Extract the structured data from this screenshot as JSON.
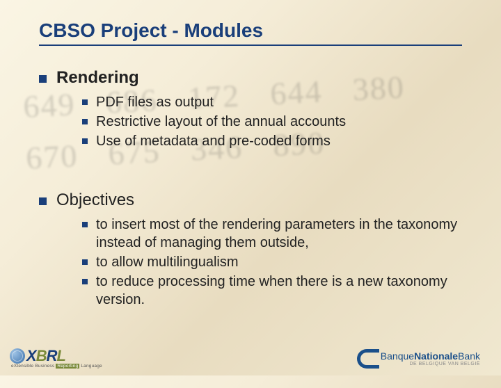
{
  "bg_numbers": "649 686 172 644\n380 670 675\n346 890",
  "title": "CBSO Project - Modules",
  "sections": [
    {
      "heading": "Rendering",
      "bold": true,
      "items": [
        "PDF files as output",
        "Restrictive layout of the annual accounts",
        "Use of metadata and pre-coded forms"
      ]
    },
    {
      "heading": "Objectives",
      "bold": false,
      "items": [
        "to insert most of the rendering parameters in the taxonomy instead of managing them outside,",
        "to allow multilingualism",
        "to reduce processing time when there is a new taxonomy version."
      ]
    }
  ],
  "logos": {
    "xbrl": {
      "letters": [
        "X",
        "B",
        "R",
        "L"
      ],
      "tagline_pre": "eXtensible Business ",
      "tagline_hl": "Reporting",
      "tagline_post": " Language"
    },
    "bnb": {
      "part1": "Banque",
      "part2": "Nationale",
      "part3": "Bank",
      "sub": "DE BELGIQUE    VAN BELGIË"
    }
  }
}
